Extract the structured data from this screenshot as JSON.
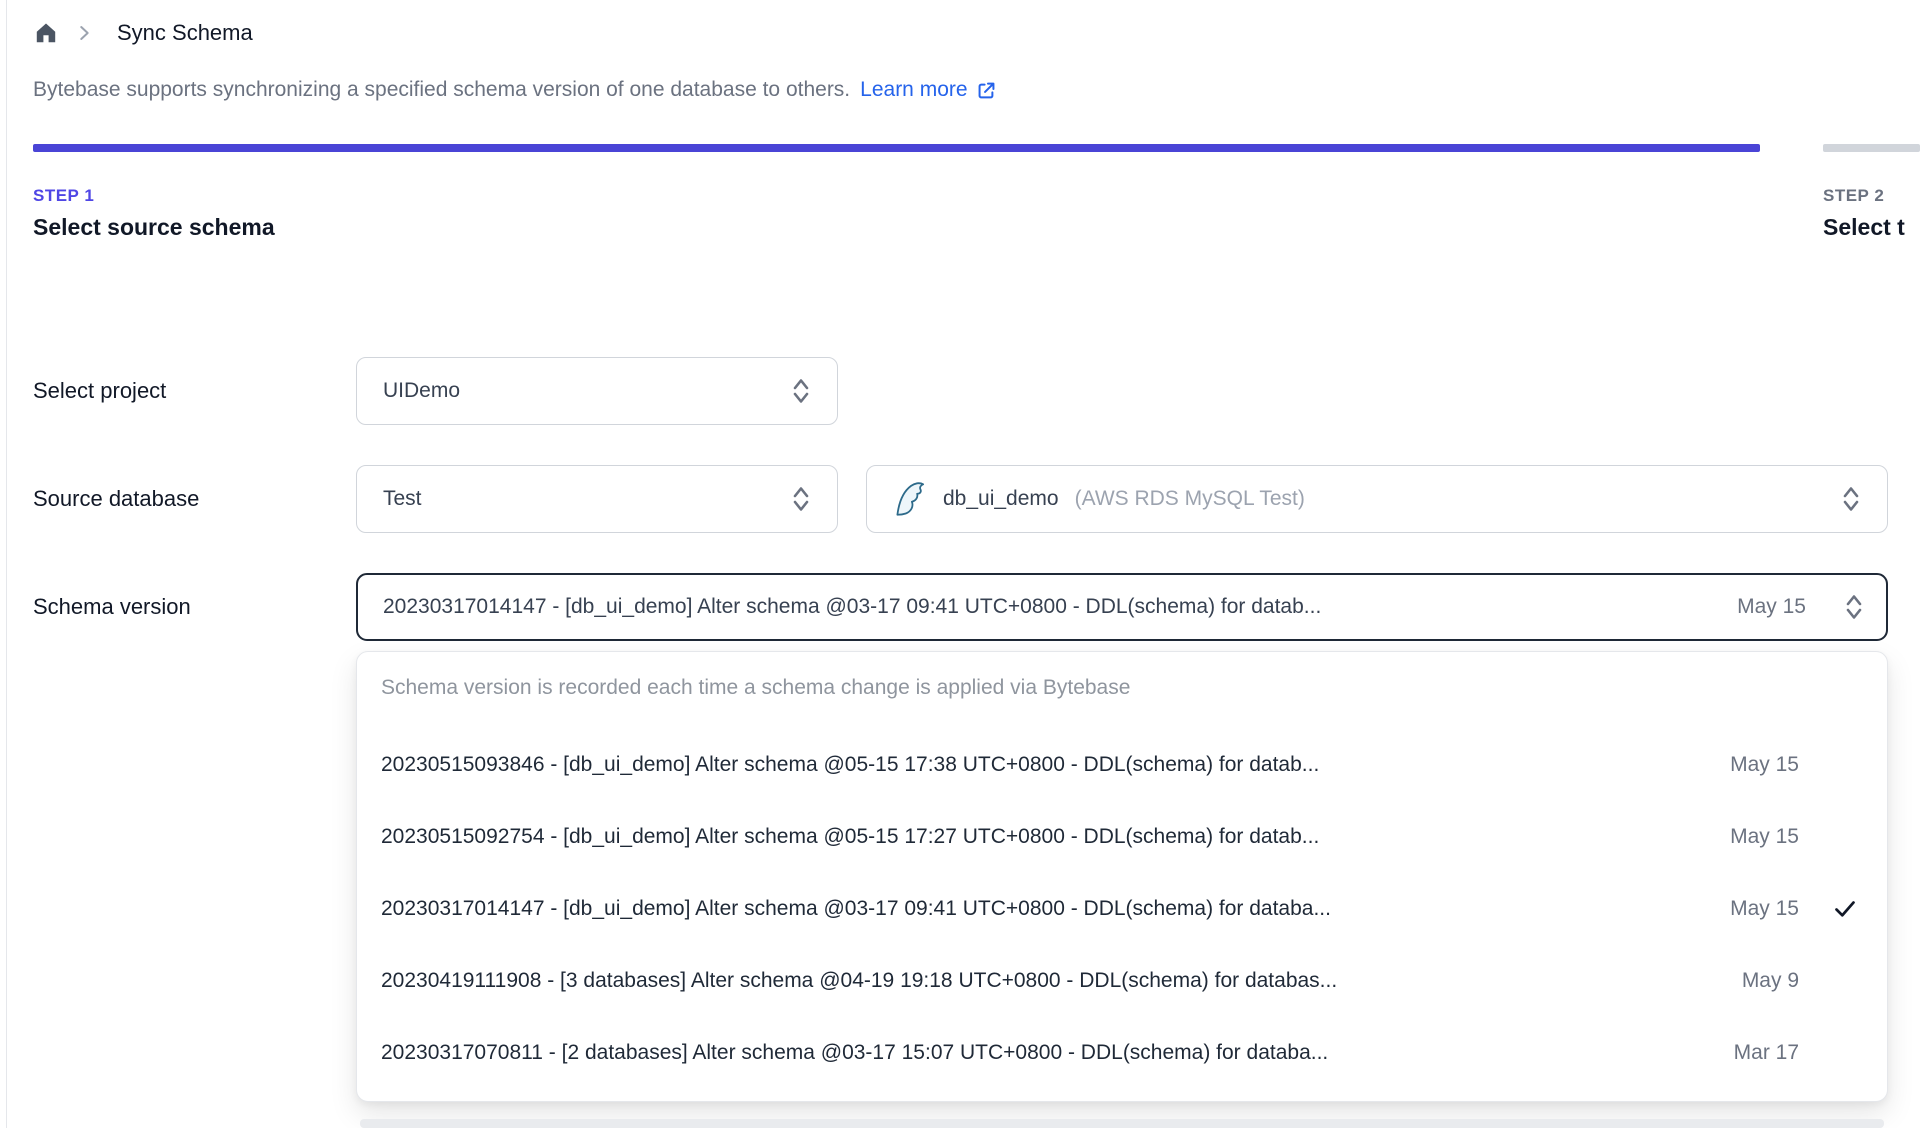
{
  "breadcrumb": {
    "page": "Sync Schema"
  },
  "intro": {
    "text": "Bytebase supports synchronizing a specified schema version of one database to others.",
    "link_label": "Learn more"
  },
  "steps": [
    {
      "step": "STEP 1",
      "title": "Select source schema"
    },
    {
      "step": "STEP 2",
      "title": "Select t"
    }
  ],
  "form": {
    "project": {
      "label": "Select project",
      "value": "UIDemo"
    },
    "source_database": {
      "label": "Source database",
      "value": "Test",
      "db_name": "db_ui_demo",
      "db_instance": "(AWS RDS MySQL Test)"
    },
    "schema_version": {
      "label": "Schema version",
      "value": "20230317014147 - [db_ui_demo] Alter schema @03-17 09:41 UTC+0800 - DDL(schema) for datab...",
      "date": "May 15"
    }
  },
  "dropdown": {
    "hint": "Schema version is recorded each time a schema change is applied via Bytebase",
    "items": [
      {
        "text": "20230515093846 - [db_ui_demo] Alter schema @05-15 17:38 UTC+0800 - DDL(schema) for datab...",
        "date": "May 15",
        "selected": false
      },
      {
        "text": "20230515092754 - [db_ui_demo] Alter schema @05-15 17:27 UTC+0800 - DDL(schema) for datab...",
        "date": "May 15",
        "selected": false
      },
      {
        "text": "20230317014147 - [db_ui_demo] Alter schema @03-17 09:41 UTC+0800 - DDL(schema) for databa...",
        "date": "May 15",
        "selected": true
      },
      {
        "text": "20230419111908 - [3 databases] Alter schema @04-19 19:18 UTC+0800 - DDL(schema) for databas...",
        "date": "May 9",
        "selected": false
      },
      {
        "text": "20230317070811 - [2 databases] Alter schema @03-17 15:07 UTC+0800 - DDL(schema) for databa...",
        "date": "Mar 17",
        "selected": false
      }
    ]
  },
  "colors": {
    "accent": "#4f46e5",
    "progress_active": "#4a44d6",
    "progress_inactive": "#d1d5db",
    "link": "#2563eb",
    "text_muted": "#6b7280"
  }
}
